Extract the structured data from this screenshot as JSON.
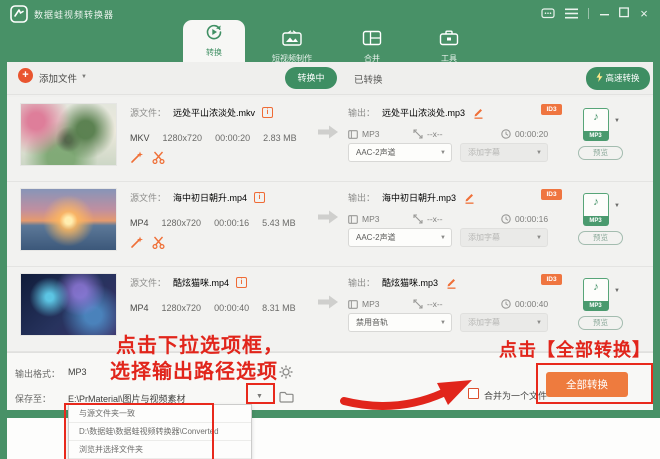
{
  "window": {
    "title": "数据蛙视频转换器"
  },
  "tabs": [
    {
      "label": "转换"
    },
    {
      "label": "短视频制作"
    },
    {
      "label": "合并"
    },
    {
      "label": "工具"
    }
  ],
  "toolbar": {
    "add_file": "添加文件",
    "tab_converting": "转换中",
    "tab_converted": "已转换",
    "fast_convert": "高速转换"
  },
  "labels": {
    "source": "源文件：",
    "output": "输出：",
    "id3": "ID3",
    "preview": "预览"
  },
  "rows": [
    {
      "name": "远处平山浓淡处.mkv",
      "format": "MKV",
      "resolution": "1280x720",
      "duration": "00:00:20",
      "size": "2.83 MB",
      "output_name": "远处平山浓淡处.mp3",
      "output_format": "MP3",
      "output_resolution": "--x--",
      "output_duration": "00:00:20",
      "audio_option": "AAC-2声道",
      "subtitle_option": "添加字幕",
      "target_format": "MP3"
    },
    {
      "name": "海中初日朝升.mp4",
      "format": "MP4",
      "resolution": "1280x720",
      "duration": "00:00:16",
      "size": "5.43 MB",
      "output_name": "海中初日朝升.mp3",
      "output_format": "MP3",
      "output_resolution": "--x--",
      "output_duration": "00:00:16",
      "audio_option": "AAC-2声道",
      "subtitle_option": "添加字幕",
      "target_format": "MP3"
    },
    {
      "name": "酷炫猫咪.mp4",
      "format": "MP4",
      "resolution": "1280x720",
      "duration": "00:00:40",
      "size": "8.31 MB",
      "output_name": "酷炫猫咪.mp3",
      "output_format": "MP3",
      "output_resolution": "--x--",
      "output_duration": "00:00:40",
      "audio_option": "禁用音轨",
      "subtitle_option": "添加字幕",
      "target_format": "MP3"
    }
  ],
  "bottom": {
    "output_format_label": "输出格式：",
    "output_format_value": "MP3",
    "save_to_label": "保存至：",
    "save_to_value": "E:\\PrMaterial\\图片与视频素材",
    "menu_items": [
      "与源文件夹一致",
      "D:\\数据蛙\\数据蛙视频转换器\\Converted",
      "浏览并选择文件夹"
    ],
    "merge_label": "合并为一个文件",
    "convert_all_label": "全部转换"
  },
  "annotations": {
    "left_line1": "点击下拉选项框，",
    "left_line2": "选择输出路径选项",
    "right": "点击【全部转换】"
  },
  "glyphs": {
    "dropdown": "▼",
    "plus": "+",
    "info": "i",
    "note": "♪",
    "close": "×"
  }
}
